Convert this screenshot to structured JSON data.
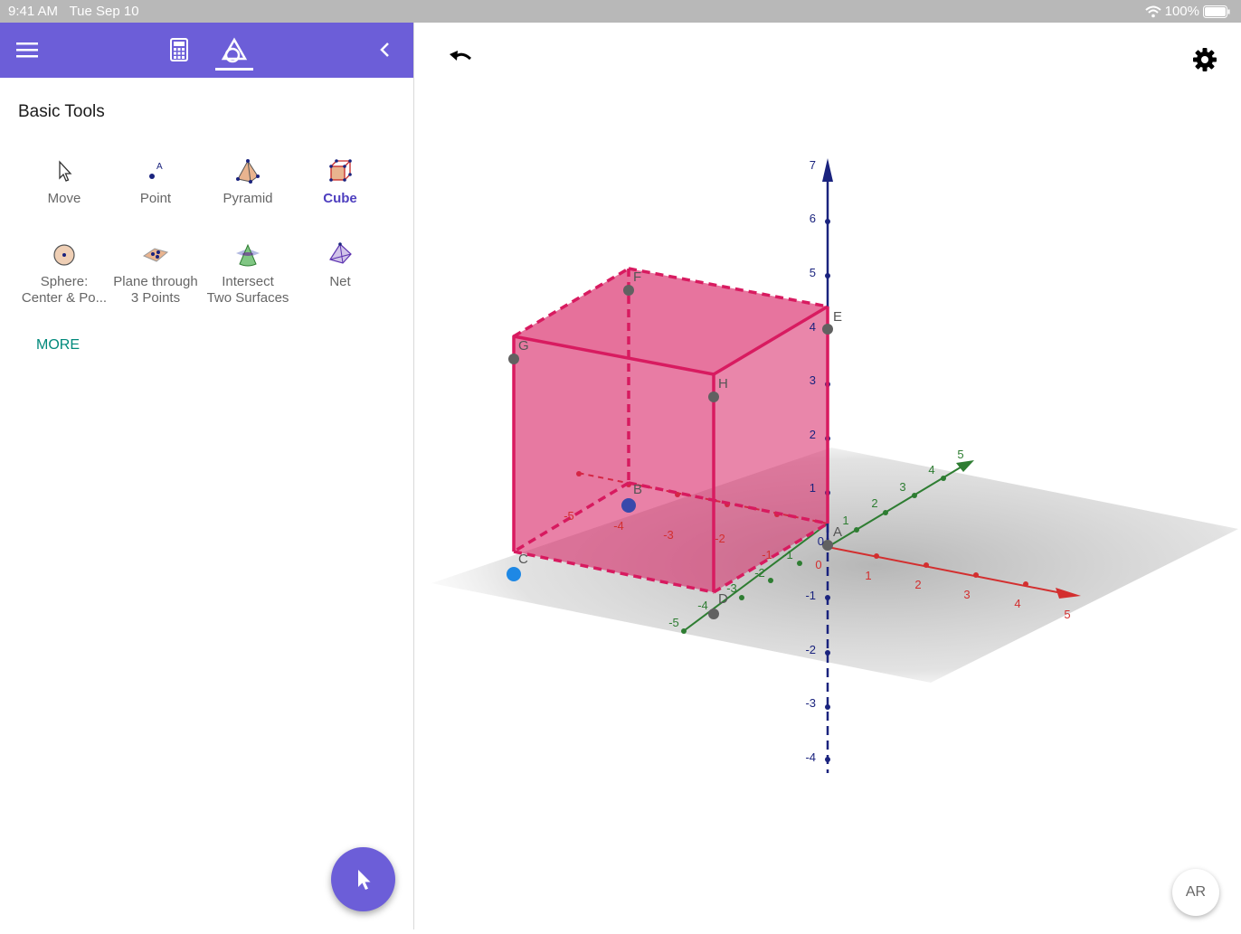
{
  "status_bar": {
    "time": "9:41 AM",
    "date": "Tue Sep 10",
    "battery": "100%"
  },
  "sidebar": {
    "section_title": "Basic Tools",
    "tools": [
      {
        "label": "Move",
        "icon": "move-arrow-icon"
      },
      {
        "label": "Point",
        "icon": "point-icon"
      },
      {
        "label": "Pyramid",
        "icon": "pyramid-icon"
      },
      {
        "label": "Cube",
        "icon": "cube-icon",
        "selected": true
      },
      {
        "label": "Sphere:",
        "label2": "Center & Po...",
        "icon": "sphere-icon"
      },
      {
        "label": "Plane through",
        "label2": "3 Points",
        "icon": "plane-icon"
      },
      {
        "label": "Intersect",
        "label2": "Two Surfaces",
        "icon": "intersect-icon"
      },
      {
        "label": "Net",
        "icon": "net-icon"
      }
    ],
    "more_label": "MORE"
  },
  "graphics": {
    "ar_label": "AR",
    "points": {
      "A": "A",
      "B": "B",
      "C": "C",
      "D": "D",
      "E": "E",
      "F": "F",
      "G": "G",
      "H": "H"
    },
    "z_ticks": [
      "7",
      "6",
      "5",
      "4",
      "3",
      "2",
      "1",
      "0",
      "-1",
      "-2",
      "-3",
      "-4"
    ],
    "x_ticks": [
      "0",
      "1",
      "2",
      "3",
      "4",
      "5",
      "-1",
      "-2",
      "-3",
      "-4",
      "-5"
    ],
    "y_ticks": [
      "1",
      "2",
      "3",
      "4",
      "5",
      "-1",
      "-2",
      "-3",
      "-4",
      "-5"
    ],
    "colors": {
      "accent": "#6c5ed8",
      "cube": "#d81b60",
      "x_axis": "#d32f2f",
      "y_axis": "#2e7d32",
      "z_axis": "#1a237e"
    }
  }
}
